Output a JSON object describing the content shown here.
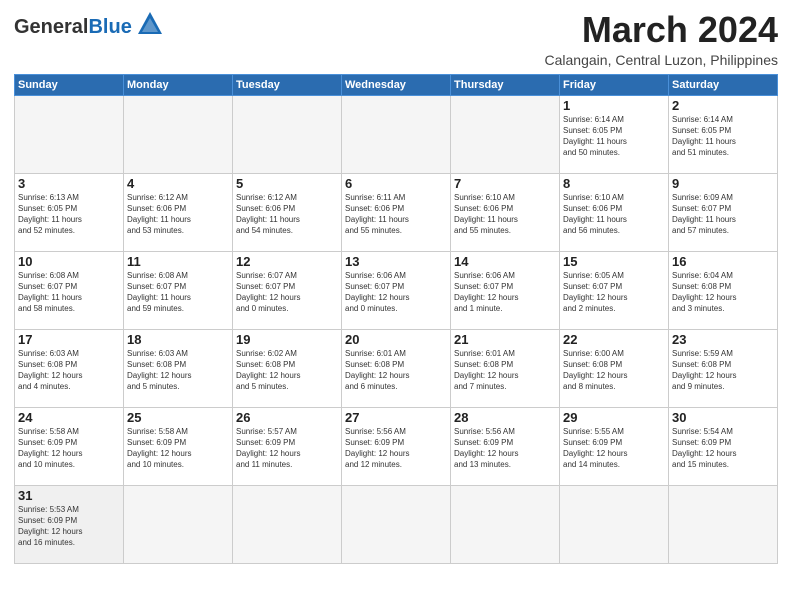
{
  "header": {
    "logo_general": "General",
    "logo_blue": "Blue",
    "main_title": "March 2024",
    "subtitle": "Calangain, Central Luzon, Philippines"
  },
  "weekdays": [
    "Sunday",
    "Monday",
    "Tuesday",
    "Wednesday",
    "Thursday",
    "Friday",
    "Saturday"
  ],
  "weeks": [
    [
      {
        "day": "",
        "info": ""
      },
      {
        "day": "",
        "info": ""
      },
      {
        "day": "",
        "info": ""
      },
      {
        "day": "",
        "info": ""
      },
      {
        "day": "",
        "info": ""
      },
      {
        "day": "1",
        "info": "Sunrise: 6:14 AM\nSunset: 6:05 PM\nDaylight: 11 hours\nand 50 minutes."
      },
      {
        "day": "2",
        "info": "Sunrise: 6:14 AM\nSunset: 6:05 PM\nDaylight: 11 hours\nand 51 minutes."
      }
    ],
    [
      {
        "day": "3",
        "info": "Sunrise: 6:13 AM\nSunset: 6:05 PM\nDaylight: 11 hours\nand 52 minutes."
      },
      {
        "day": "4",
        "info": "Sunrise: 6:12 AM\nSunset: 6:06 PM\nDaylight: 11 hours\nand 53 minutes."
      },
      {
        "day": "5",
        "info": "Sunrise: 6:12 AM\nSunset: 6:06 PM\nDaylight: 11 hours\nand 54 minutes."
      },
      {
        "day": "6",
        "info": "Sunrise: 6:11 AM\nSunset: 6:06 PM\nDaylight: 11 hours\nand 55 minutes."
      },
      {
        "day": "7",
        "info": "Sunrise: 6:10 AM\nSunset: 6:06 PM\nDaylight: 11 hours\nand 55 minutes."
      },
      {
        "day": "8",
        "info": "Sunrise: 6:10 AM\nSunset: 6:06 PM\nDaylight: 11 hours\nand 56 minutes."
      },
      {
        "day": "9",
        "info": "Sunrise: 6:09 AM\nSunset: 6:07 PM\nDaylight: 11 hours\nand 57 minutes."
      }
    ],
    [
      {
        "day": "10",
        "info": "Sunrise: 6:08 AM\nSunset: 6:07 PM\nDaylight: 11 hours\nand 58 minutes."
      },
      {
        "day": "11",
        "info": "Sunrise: 6:08 AM\nSunset: 6:07 PM\nDaylight: 11 hours\nand 59 minutes."
      },
      {
        "day": "12",
        "info": "Sunrise: 6:07 AM\nSunset: 6:07 PM\nDaylight: 12 hours\nand 0 minutes."
      },
      {
        "day": "13",
        "info": "Sunrise: 6:06 AM\nSunset: 6:07 PM\nDaylight: 12 hours\nand 0 minutes."
      },
      {
        "day": "14",
        "info": "Sunrise: 6:06 AM\nSunset: 6:07 PM\nDaylight: 12 hours\nand 1 minute."
      },
      {
        "day": "15",
        "info": "Sunrise: 6:05 AM\nSunset: 6:07 PM\nDaylight: 12 hours\nand 2 minutes."
      },
      {
        "day": "16",
        "info": "Sunrise: 6:04 AM\nSunset: 6:08 PM\nDaylight: 12 hours\nand 3 minutes."
      }
    ],
    [
      {
        "day": "17",
        "info": "Sunrise: 6:03 AM\nSunset: 6:08 PM\nDaylight: 12 hours\nand 4 minutes."
      },
      {
        "day": "18",
        "info": "Sunrise: 6:03 AM\nSunset: 6:08 PM\nDaylight: 12 hours\nand 5 minutes."
      },
      {
        "day": "19",
        "info": "Sunrise: 6:02 AM\nSunset: 6:08 PM\nDaylight: 12 hours\nand 5 minutes."
      },
      {
        "day": "20",
        "info": "Sunrise: 6:01 AM\nSunset: 6:08 PM\nDaylight: 12 hours\nand 6 minutes."
      },
      {
        "day": "21",
        "info": "Sunrise: 6:01 AM\nSunset: 6:08 PM\nDaylight: 12 hours\nand 7 minutes."
      },
      {
        "day": "22",
        "info": "Sunrise: 6:00 AM\nSunset: 6:08 PM\nDaylight: 12 hours\nand 8 minutes."
      },
      {
        "day": "23",
        "info": "Sunrise: 5:59 AM\nSunset: 6:08 PM\nDaylight: 12 hours\nand 9 minutes."
      }
    ],
    [
      {
        "day": "24",
        "info": "Sunrise: 5:58 AM\nSunset: 6:09 PM\nDaylight: 12 hours\nand 10 minutes."
      },
      {
        "day": "25",
        "info": "Sunrise: 5:58 AM\nSunset: 6:09 PM\nDaylight: 12 hours\nand 10 minutes."
      },
      {
        "day": "26",
        "info": "Sunrise: 5:57 AM\nSunset: 6:09 PM\nDaylight: 12 hours\nand 11 minutes."
      },
      {
        "day": "27",
        "info": "Sunrise: 5:56 AM\nSunset: 6:09 PM\nDaylight: 12 hours\nand 12 minutes."
      },
      {
        "day": "28",
        "info": "Sunrise: 5:56 AM\nSunset: 6:09 PM\nDaylight: 12 hours\nand 13 minutes."
      },
      {
        "day": "29",
        "info": "Sunrise: 5:55 AM\nSunset: 6:09 PM\nDaylight: 12 hours\nand 14 minutes."
      },
      {
        "day": "30",
        "info": "Sunrise: 5:54 AM\nSunset: 6:09 PM\nDaylight: 12 hours\nand 15 minutes."
      }
    ],
    [
      {
        "day": "31",
        "info": "Sunrise: 5:53 AM\nSunset: 6:09 PM\nDaylight: 12 hours\nand 16 minutes."
      },
      {
        "day": "",
        "info": ""
      },
      {
        "day": "",
        "info": ""
      },
      {
        "day": "",
        "info": ""
      },
      {
        "day": "",
        "info": ""
      },
      {
        "day": "",
        "info": ""
      },
      {
        "day": "",
        "info": ""
      }
    ]
  ]
}
